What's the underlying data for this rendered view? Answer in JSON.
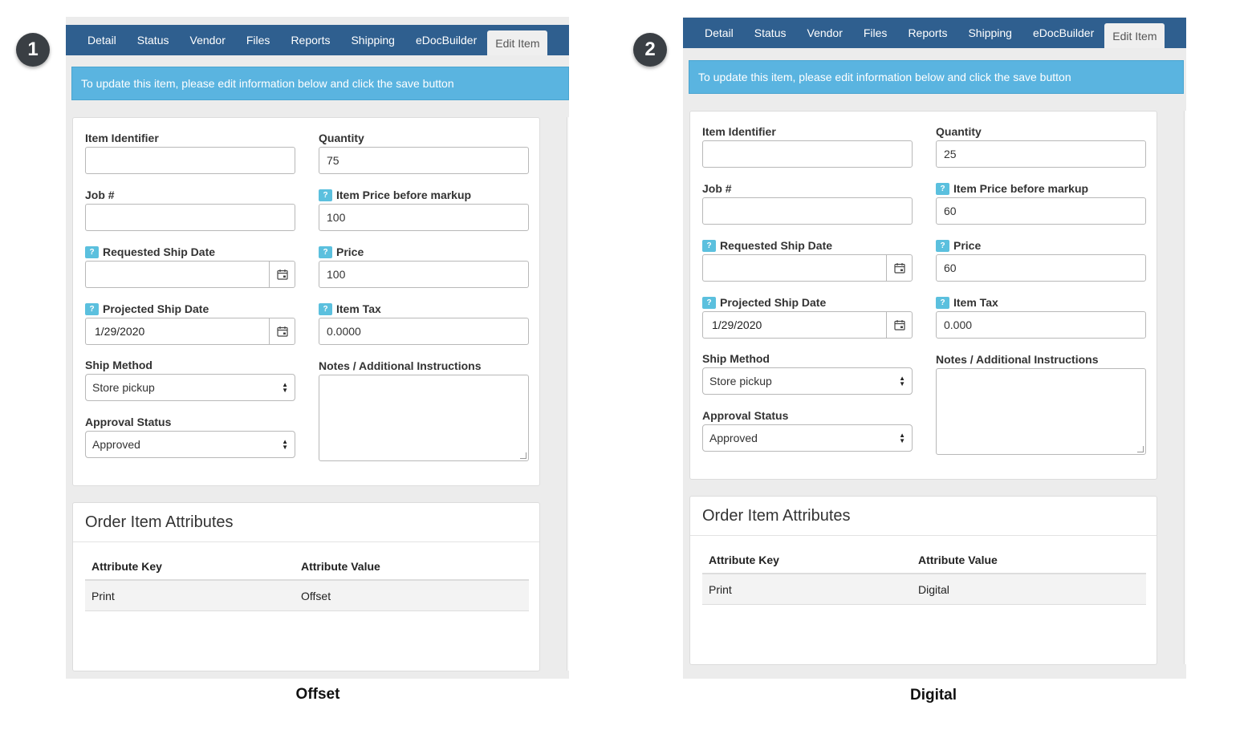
{
  "colors": {
    "tabbar": "#2f5f8f",
    "alert": "#5ab4e0",
    "help_badge": "#5bc0de",
    "badge": "#3a3f44"
  },
  "panels": [
    {
      "number": "1",
      "caption": "Offset",
      "tabs": [
        "Detail",
        "Status",
        "Vendor",
        "Files",
        "Reports",
        "Shipping",
        "eDocBuilder",
        "Edit Item"
      ],
      "active_tab": "Edit Item",
      "alert": "To update this item, please edit information below and click the save button",
      "form": {
        "item_identifier": {
          "label": "Item Identifier",
          "value": ""
        },
        "job": {
          "label": "Job #",
          "value": ""
        },
        "requested_ship_date": {
          "label": "Requested Ship Date",
          "value": "",
          "help": "?"
        },
        "projected_ship_date": {
          "label": "Projected Ship Date",
          "value": "1/29/2020",
          "help": "?"
        },
        "ship_method": {
          "label": "Ship Method",
          "value": "Store pickup"
        },
        "approval_status": {
          "label": "Approval Status",
          "value": "Approved"
        },
        "quantity": {
          "label": "Quantity",
          "value": "75"
        },
        "item_price_before_markup": {
          "label": "Item Price before markup",
          "value": "100",
          "help": "?"
        },
        "price": {
          "label": "Price",
          "value": "100",
          "help": "?"
        },
        "item_tax": {
          "label": "Item Tax",
          "value": "0.0000",
          "help": "?"
        },
        "notes": {
          "label": "Notes / Additional Instructions",
          "value": ""
        }
      },
      "attributes": {
        "title": "Order Item Attributes",
        "headers": [
          "Attribute Key",
          "Attribute Value"
        ],
        "rows": [
          [
            "Print",
            "Offset"
          ]
        ]
      }
    },
    {
      "number": "2",
      "caption": "Digital",
      "tabs": [
        "Detail",
        "Status",
        "Vendor",
        "Files",
        "Reports",
        "Shipping",
        "eDocBuilder",
        "Edit Item"
      ],
      "active_tab": "Edit Item",
      "alert": "To update this item, please edit information below and click the save button",
      "form": {
        "item_identifier": {
          "label": "Item Identifier",
          "value": ""
        },
        "job": {
          "label": "Job #",
          "value": ""
        },
        "requested_ship_date": {
          "label": "Requested Ship Date",
          "value": "",
          "help": "?"
        },
        "projected_ship_date": {
          "label": "Projected Ship Date",
          "value": "1/29/2020",
          "help": "?"
        },
        "ship_method": {
          "label": "Ship Method",
          "value": "Store pickup"
        },
        "approval_status": {
          "label": "Approval Status",
          "value": "Approved"
        },
        "quantity": {
          "label": "Quantity",
          "value": "25"
        },
        "item_price_before_markup": {
          "label": "Item Price before markup",
          "value": "60",
          "help": "?"
        },
        "price": {
          "label": "Price",
          "value": "60",
          "help": "?"
        },
        "item_tax": {
          "label": "Item Tax",
          "value": "0.000",
          "help": "?"
        },
        "notes": {
          "label": "Notes / Additional Instructions",
          "value": ""
        }
      },
      "attributes": {
        "title": "Order Item Attributes",
        "headers": [
          "Attribute Key",
          "Attribute Value"
        ],
        "rows": [
          [
            "Print",
            "Digital"
          ]
        ]
      }
    }
  ]
}
